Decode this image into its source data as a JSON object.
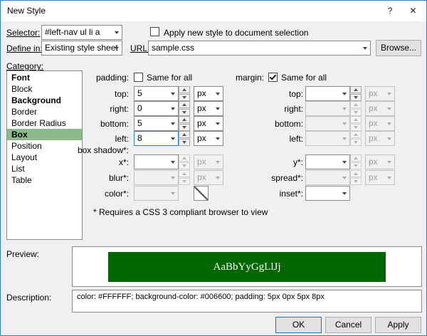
{
  "window": {
    "title": "New Style",
    "help": "?",
    "close": "✕"
  },
  "header": {
    "selector_label": "Selector:",
    "selector_value": "#left-nav ul li a",
    "apply_label": "Apply new style to document selection",
    "define_in_label": "Define in:",
    "define_in_value": "Existing style sheet",
    "url_label": "URL:",
    "url_value": "sample.css",
    "browse_label": "Browse..."
  },
  "category": {
    "label": "Category:",
    "items": [
      "Font",
      "Block",
      "Background",
      "Border",
      "Border Radius",
      "Box",
      "Position",
      "Layout",
      "List",
      "Table"
    ]
  },
  "box": {
    "padding_label": "padding:",
    "margin_label": "margin:",
    "same_for_all": "Same for all",
    "padding_rows": [
      {
        "label": "top:",
        "value": "5",
        "unit": "px"
      },
      {
        "label": "right:",
        "value": "0",
        "unit": "px"
      },
      {
        "label": "bottom:",
        "value": "5",
        "unit": "px"
      },
      {
        "label": "left:",
        "value": "8",
        "unit": "px"
      }
    ],
    "margin_rows": [
      {
        "label": "top:",
        "value": "",
        "unit": "px"
      },
      {
        "label": "right:",
        "value": "",
        "unit": "px"
      },
      {
        "label": "bottom:",
        "value": "",
        "unit": "px"
      },
      {
        "label": "left:",
        "value": "",
        "unit": "px"
      }
    ],
    "box_shadow_label": "box shadow*:",
    "x_label": "x*:",
    "y_label": "y*:",
    "blur_label": "blur*:",
    "spread_label": "spread*:",
    "color_label": "color*:",
    "inset_label": "inset*:",
    "unit": "px",
    "note": "* Requires a CSS 3 compliant browser to view"
  },
  "preview": {
    "label": "Preview:",
    "text": "AaBbYyGgLlJj",
    "bg": "#006600",
    "fg": "#FFFFFF"
  },
  "description": {
    "label": "Description:",
    "text": "color: #FFFFFF; background-color: #006600; padding: 5px 0px 5px 8px"
  },
  "footer": {
    "ok": "OK",
    "cancel": "Cancel",
    "apply": "Apply"
  }
}
